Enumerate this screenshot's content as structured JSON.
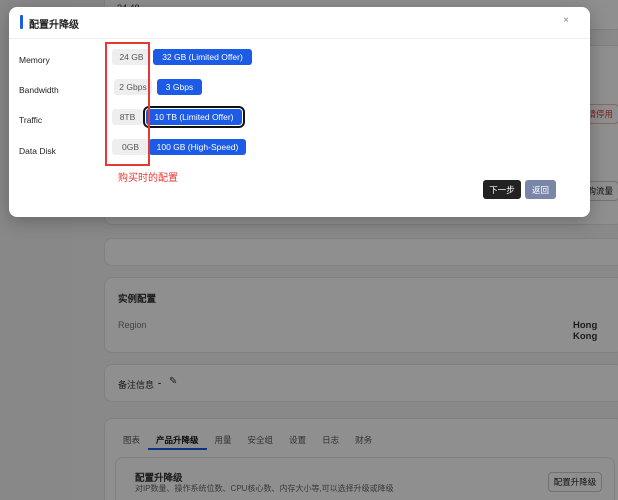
{
  "background": {
    "top_value": "24 48",
    "stop_button": "申请停用",
    "buy_traffic": "订购流量",
    "instance_config_title": "实例配置",
    "region_label": "Region",
    "region_value": "Hong Kong",
    "remark_label": "备注信息",
    "remark_value": "-",
    "tabs": [
      "图表",
      "产品升降级",
      "用量",
      "安全组",
      "设置",
      "日志",
      "财务"
    ],
    "active_tab": 1,
    "upgrade_section_title": "配置升降级",
    "upgrade_section_desc": "对IP数量、操作系统位数、CPU核心数、内存大小等,可以选择升级或降级",
    "upgrade_section_button": "配置升降级",
    "edit_icon": "pencil-icon"
  },
  "modal": {
    "title": "配置升降级",
    "close_icon": "close-icon",
    "rows": [
      {
        "label": "Memory",
        "current": "24 GB",
        "option": "32 GB (Limited Offer)"
      },
      {
        "label": "Bandwidth",
        "current": "2 Gbps",
        "option": "3 Gbps"
      },
      {
        "label": "Traffic",
        "current": "8TB",
        "option": "10 TB (Limited Offer)"
      },
      {
        "label": "Data Disk",
        "current": "0GB",
        "option": "100 GB (High-Speed)"
      }
    ],
    "annotation": "购买时的配置",
    "next_button": "下一步",
    "back_button": "返回",
    "accent_color": "#1c5be6",
    "annotation_color": "#e53935"
  }
}
